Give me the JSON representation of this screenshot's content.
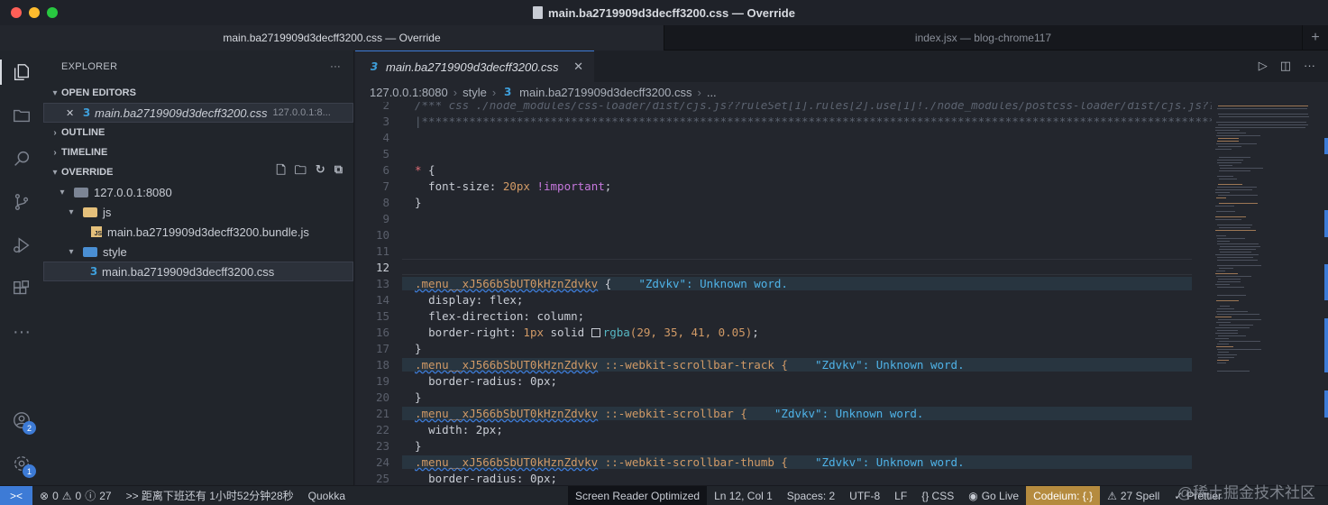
{
  "window": {
    "title": "main.ba2719909d3decff3200.css — Override"
  },
  "window_tabs": [
    {
      "label": "main.ba2719909d3decff3200.css — Override"
    },
    {
      "label": "index.jsx — blog-chrome117"
    }
  ],
  "activity_bar": {
    "icons": [
      "files-icon",
      "folder-icon",
      "search-icon",
      "source-control-icon",
      "run-debug-icon",
      "extensions-icon",
      "more-icon",
      "account-icon",
      "settings-gear-icon"
    ],
    "account_badge": "2",
    "settings_badge": "1"
  },
  "sidebar": {
    "title": "EXPLORER",
    "more": "···",
    "open_editors": {
      "label": "OPEN EDITORS",
      "items": [
        {
          "close": "✕",
          "name": "main.ba2719909d3decff3200.css",
          "path": "127.0.0.1:8..."
        }
      ]
    },
    "outline": "OUTLINE",
    "timeline": "TIMELINE",
    "override": {
      "label": "OVERRIDE",
      "tree": {
        "root": "127.0.0.1:8080",
        "js_folder": "js",
        "js_file": "main.ba2719909d3decff3200.bundle.js",
        "style_folder": "style",
        "css_file": "main.ba2719909d3decff3200.css"
      }
    }
  },
  "editor": {
    "tab": {
      "name": "main.ba2719909d3decff3200.css",
      "close": "✕"
    },
    "breadcrumb": [
      "127.0.0.1:8080",
      "style",
      "main.ba2719909d3decff3200.css",
      "..."
    ],
    "lines": {
      "l2": "/*** css ./node_modules/css-loader/dist/cjs.js??ruleSet[1].rules[2].use[1]!./node_modules/postcss-loader/dist/cjs.js??ru",
      "l3": "|*************************************************************************************************************************",
      "l13_sel": ".menu__xJ566bSbUT0kHznZdvkv",
      "l13_err": "\"Zdvkv\": Unknown word.",
      "l14": "display: flex;",
      "l15": "flex-direction: column;",
      "l16_prop": "border-right: ",
      "l16_num": "1px",
      "l16_kw": " solid ",
      "l16_fn": "rgba",
      "l16_args": "(29, 35, 41, 0.05)",
      "l18_sel": ".menu__xJ566bSbUT0kHznZdvkv",
      "l18_pseudo": " ::-webkit-scrollbar-track {",
      "l18_err": "\"Zdvkv\": Unknown word.",
      "l19": "border-radius: 0px;",
      "l21_pseudo": " ::-webkit-scrollbar {",
      "l21_err": "\"Zdvkv\": Unknown word.",
      "l22": "width: 2px;",
      "l24_pseudo": " ::-webkit-scrollbar-thumb {",
      "l24_err": "\"Zdvkv\": Unknown word.",
      "l25": "border-radius: 0px;"
    }
  },
  "statusbar": {
    "remote": "><",
    "errors": "0",
    "warnings": "0",
    "info": "27",
    "countdown": ">> 距离下班还有 1小时52分钟28秒",
    "quokka": "Quokka",
    "screen_reader": "Screen Reader Optimized",
    "position": "Ln 12, Col 1",
    "spaces": "Spaces: 2",
    "encoding": "UTF-8",
    "eol": "LF",
    "language": "{} CSS",
    "go_live": "Go Live",
    "codeium": "Codeium: {.}",
    "spell": "27 Spell",
    "prettier": "Prettier"
  },
  "watermark": "@稀土掘金技术社区",
  "colors": {
    "accent": "#3d7bd6",
    "codeium": "#b58b3f",
    "selector": "#d19a66",
    "error_text": "#4fb3e8"
  }
}
